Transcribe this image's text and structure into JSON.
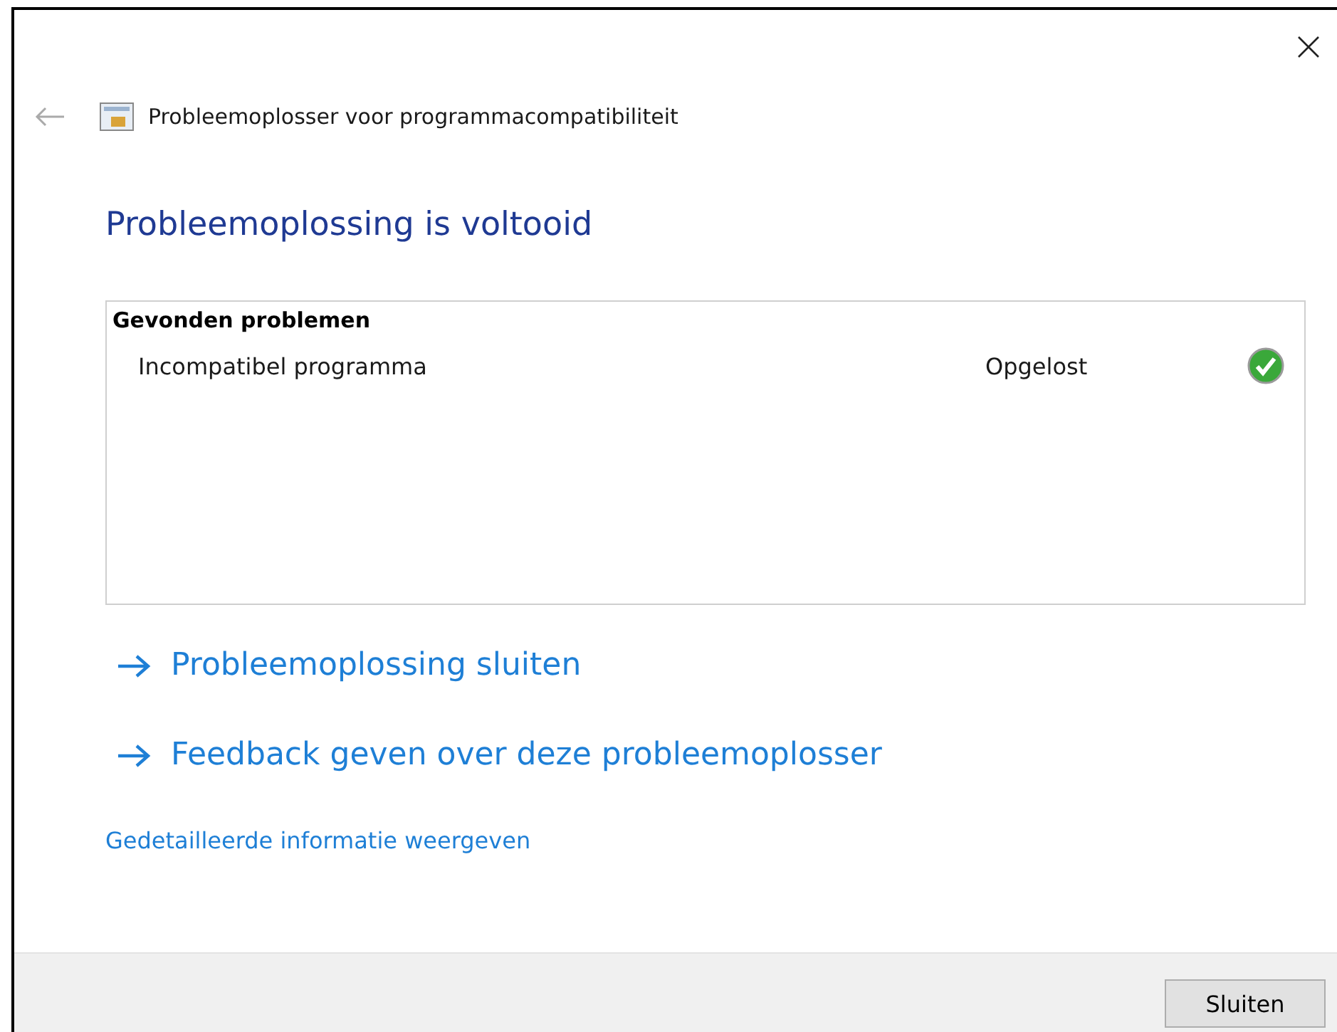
{
  "window": {
    "title": "Probleemoplosser voor programmacompatibiliteit"
  },
  "heading": "Probleemoplossing is voltooid",
  "problems": {
    "title": "Gevonden problemen",
    "items": [
      {
        "name": "Incompatibel programma",
        "status": "Opgelost",
        "resolved": true
      }
    ]
  },
  "actions": [
    "Probleemoplossing sluiten",
    "Feedback geven over deze probleemoplosser"
  ],
  "details_link": "Gedetailleerde informatie weergeven",
  "footer": {
    "button": "Sluiten"
  }
}
